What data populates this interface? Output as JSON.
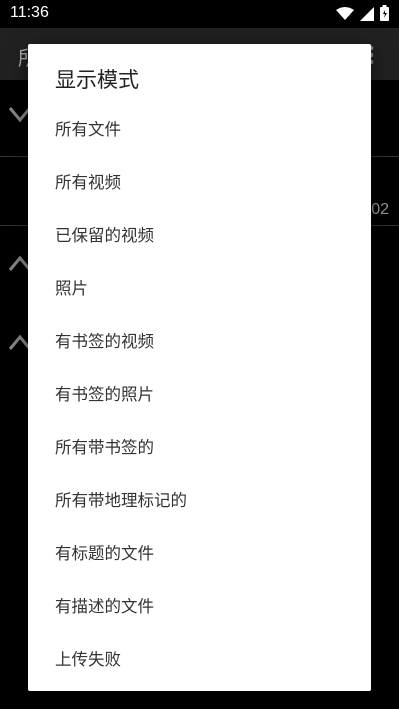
{
  "status_bar": {
    "time": "11:36"
  },
  "app_bar": {
    "title_partial": "所"
  },
  "background": {
    "row_value_partial": "02"
  },
  "dialog": {
    "title": "显示模式",
    "options": [
      "所有文件",
      "所有视频",
      "已保留的视频",
      "照片",
      "有书签的视频",
      "有书签的照片",
      "所有带书签的",
      "所有带地理标记的",
      "有标题的文件",
      "有描述的文件",
      "上传失败"
    ]
  }
}
